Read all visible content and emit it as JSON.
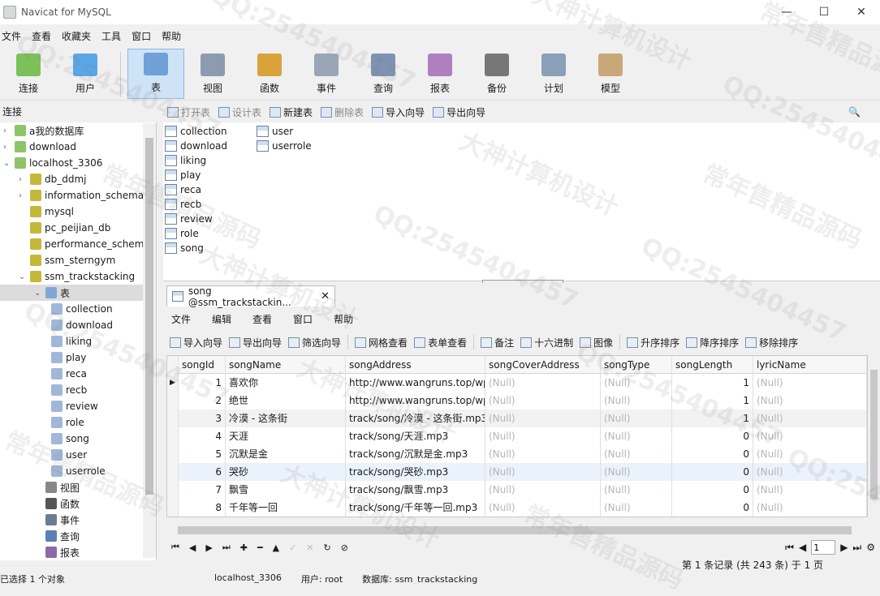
{
  "window": {
    "title": "Navicat for MySQL"
  },
  "menu": [
    "文件",
    "查看",
    "收藏夹",
    "工具",
    "窗口",
    "帮助"
  ],
  "toolbar": [
    {
      "label": "连接",
      "icon": "connection-icon",
      "color": "#7cc05a"
    },
    {
      "label": "用户",
      "icon": "user-icon",
      "color": "#5aa7e6"
    },
    {
      "label": "表",
      "icon": "table-icon",
      "color": "#6fa0d8",
      "active": true
    },
    {
      "label": "视图",
      "icon": "view-icon",
      "color": "#8c9bb0"
    },
    {
      "label": "函数",
      "icon": "function-icon",
      "color": "#d9a23a"
    },
    {
      "label": "事件",
      "icon": "event-icon",
      "color": "#9aa6b5"
    },
    {
      "label": "查询",
      "icon": "query-icon",
      "color": "#7f92b3"
    },
    {
      "label": "报表",
      "icon": "report-icon",
      "color": "#b07fc0"
    },
    {
      "label": "备份",
      "icon": "backup-icon",
      "color": "#777777"
    },
    {
      "label": "计划",
      "icon": "schedule-icon",
      "color": "#8aa0b8"
    },
    {
      "label": "模型",
      "icon": "model-icon",
      "color": "#c8a778"
    }
  ],
  "connection_header": "连接",
  "subtoolbar": [
    {
      "label": "打开表",
      "disabled": true
    },
    {
      "label": "设计表",
      "disabled": true
    },
    {
      "label": "新建表",
      "disabled": false
    },
    {
      "label": "删除表",
      "disabled": true
    },
    {
      "label": "导入向导",
      "disabled": false
    },
    {
      "label": "导出向导",
      "disabled": false
    }
  ],
  "tree": [
    {
      "label": "a我的数据库",
      "icon": "connection-icon",
      "expander": "›",
      "level": 0
    },
    {
      "label": "download",
      "icon": "connection-icon",
      "expander": "›",
      "level": 0
    },
    {
      "label": "localhost_3306",
      "icon": "connection-icon",
      "expander": "⌄",
      "level": 0
    },
    {
      "label": "db_ddmj",
      "icon": "database-icon",
      "expander": "›",
      "level": 1
    },
    {
      "label": "information_schema",
      "icon": "database-icon",
      "expander": "›",
      "level": 1
    },
    {
      "label": "mysql",
      "icon": "database-icon",
      "expander": "",
      "level": 1
    },
    {
      "label": "pc_peijian_db",
      "icon": "database-icon",
      "expander": "",
      "level": 1
    },
    {
      "label": "performance_schem",
      "icon": "database-icon",
      "expander": "",
      "level": 1
    },
    {
      "label": "ssm_sterngym",
      "icon": "database-icon",
      "expander": "",
      "level": 1
    },
    {
      "label": "ssm_trackstacking",
      "icon": "database-icon",
      "expander": "⌄",
      "level": 1
    },
    {
      "label": "表",
      "icon": "table-folder-icon",
      "expander": "⌄",
      "level": 2
    },
    {
      "label": "collection",
      "icon": "table-icon",
      "expander": "",
      "level": 3
    },
    {
      "label": "download",
      "icon": "table-icon",
      "expander": "",
      "level": 3
    },
    {
      "label": "liking",
      "icon": "table-icon",
      "expander": "",
      "level": 3
    },
    {
      "label": "play",
      "icon": "table-icon",
      "expander": "",
      "level": 3
    },
    {
      "label": "reca",
      "icon": "table-icon",
      "expander": "",
      "level": 3
    },
    {
      "label": "recb",
      "icon": "table-icon",
      "expander": "",
      "level": 3
    },
    {
      "label": "review",
      "icon": "table-icon",
      "expander": "",
      "level": 3
    },
    {
      "label": "role",
      "icon": "table-icon",
      "expander": "",
      "level": 3
    },
    {
      "label": "song",
      "icon": "table-icon",
      "expander": "",
      "level": 3
    },
    {
      "label": "user",
      "icon": "table-icon",
      "expander": "",
      "level": 3
    },
    {
      "label": "userrole",
      "icon": "table-icon",
      "expander": "",
      "level": 3
    },
    {
      "label": "视图",
      "icon": "view-icon",
      "expander": "",
      "level": 2
    },
    {
      "label": "函数",
      "icon": "function-icon",
      "expander": "",
      "level": 2
    },
    {
      "label": "事件",
      "icon": "event-icon",
      "expander": "",
      "level": 2
    },
    {
      "label": "查询",
      "icon": "query-icon",
      "expander": "",
      "level": 2
    },
    {
      "label": "报表",
      "icon": "report-icon",
      "expander": "",
      "level": 2
    }
  ],
  "object_list": [
    "collection",
    "download",
    "liking",
    "play",
    "reca",
    "recb",
    "review",
    "role",
    "song",
    "user",
    "userrole"
  ],
  "doc_tab": {
    "label": "song @ssm_trackstackin...",
    "close": "✕"
  },
  "inner_menu": [
    "文件",
    "编辑",
    "查看",
    "窗口",
    "帮助"
  ],
  "grid_toolbar": [
    "导入向导",
    "导出向导",
    "筛选向导",
    "网格查看",
    "表单查看",
    "备注",
    "十六进制",
    "图像",
    "升序排序",
    "降序排序",
    "移除排序"
  ],
  "grid": {
    "columns": [
      "songId",
      "songName",
      "songAddress",
      "songCoverAddress",
      "songType",
      "songLength",
      "lyricName"
    ],
    "rows": [
      [
        "1",
        "喜欢你",
        "http://www.wangruns.top/wp",
        "(Null)",
        "(Null)",
        "1",
        "(Null)"
      ],
      [
        "2",
        "绝世",
        "http://www.wangruns.top/wp",
        "(Null)",
        "(Null)",
        "1",
        "(Null)"
      ],
      [
        "3",
        "冷漠 - 这条街",
        "track/song/冷漠 - 这条街.mp3",
        "(Null)",
        "(Null)",
        "1",
        "(Null)"
      ],
      [
        "4",
        "天涯",
        "track/song/天涯.mp3",
        "(Null)",
        "(Null)",
        "0",
        "(Null)"
      ],
      [
        "5",
        "沉默是金",
        "track/song/沉默是金.mp3",
        "(Null)",
        "(Null)",
        "0",
        "(Null)"
      ],
      [
        "6",
        "哭砂",
        "track/song/哭砂.mp3",
        "(Null)",
        "(Null)",
        "0",
        "(Null)"
      ],
      [
        "7",
        "飘雪",
        "track/song/飘雪.mp3",
        "(Null)",
        "(Null)",
        "0",
        "(Null)"
      ],
      [
        "8",
        "千年等一回",
        "track/song/千年等一回.mp3",
        "(Null)",
        "(Null)",
        "0",
        "(Null)"
      ]
    ]
  },
  "pager": {
    "page": "1"
  },
  "record_info": "第 1 条记录 (共 243 条) 于 1 页",
  "status": {
    "left": "已选择 1 个对象",
    "conn": "localhost_3306",
    "user": "用户: root",
    "db": "数据库: ssm_trackstacking"
  },
  "watermarks": [
    "QQ:2545404457",
    "常年售精品源码",
    "大神计算机设计"
  ]
}
